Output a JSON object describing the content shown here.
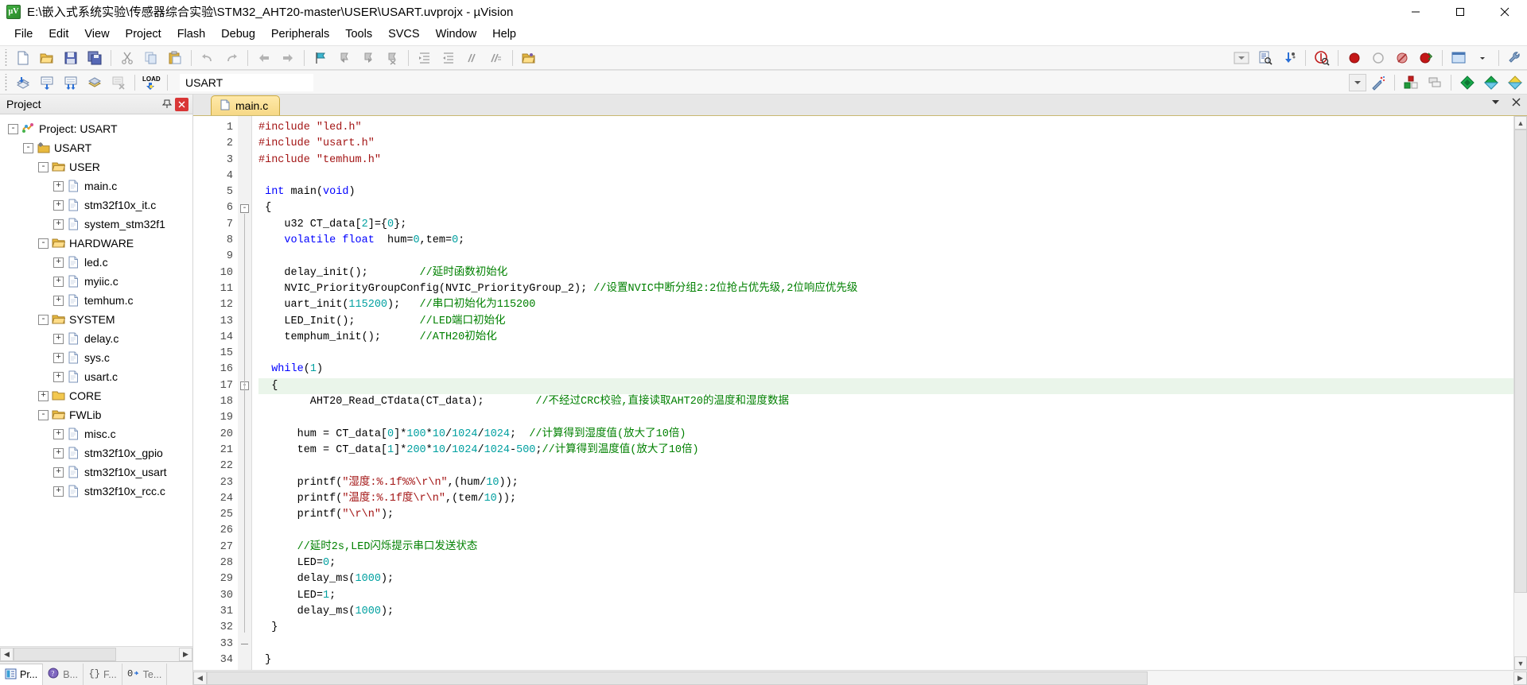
{
  "window": {
    "title": "E:\\嵌入式系统实验\\传感器综合实验\\STM32_AHT20-master\\USER\\USART.uvprojx - µVision",
    "app_icon": "uvision-logo-icon",
    "minimize": "minimize-button",
    "maximize": "maximize-button",
    "close": "close-button"
  },
  "menu": {
    "items": [
      "File",
      "Edit",
      "View",
      "Project",
      "Flash",
      "Debug",
      "Peripherals",
      "Tools",
      "SVCS",
      "Window",
      "Help"
    ]
  },
  "toolbar_main": {
    "buttons": [
      "new-file-icon",
      "open-file-icon",
      "save-icon",
      "save-all-icon",
      "cut-icon",
      "copy-icon",
      "paste-icon",
      "undo-icon",
      "redo-icon",
      "navigate-back-icon",
      "navigate-forward-icon",
      "bookmark-toggle-icon",
      "bookmark-prev-icon",
      "bookmark-next-icon",
      "bookmark-clear-icon",
      "indent-icon",
      "outdent-icon",
      "comment-icon",
      "uncomment-icon",
      "open-folder-icon",
      "dropdown-arrow-icon",
      "find-in-files-icon",
      "configure-icon",
      "debug-session-icon",
      "insert-breakpoint-icon",
      "remove-breakpoint-icon",
      "disable-breakpoint-icon",
      "kill-breakpoints-icon",
      "window-layout-icon",
      "layout-dropdown-icon",
      "configuration-wizard-icon"
    ]
  },
  "toolbar_build": {
    "buttons": [
      "translate-icon",
      "build-icon",
      "rebuild-icon",
      "batch-build-icon",
      "stop-build-icon",
      "load-icon"
    ],
    "target_label": "USART",
    "target_dropdown": "target-dropdown-icon",
    "after_buttons": [
      "magic-wand-icon",
      "manage-project-items-icon",
      "multi-project-icon",
      "pack-installer-icon",
      "manage-runtime-icon",
      "select-software-packs-icon"
    ]
  },
  "project_panel": {
    "title": "Project",
    "pin_icon": "pin-icon",
    "close_icon": "close-panel-icon",
    "tree": [
      {
        "label": "Project: USART",
        "depth": 0,
        "expander": "-",
        "icon": "project-icon"
      },
      {
        "label": "USART",
        "depth": 1,
        "expander": "-",
        "icon": "target-icon"
      },
      {
        "label": "USER",
        "depth": 2,
        "expander": "-",
        "icon": "folder-open-icon"
      },
      {
        "label": "main.c",
        "depth": 3,
        "expander": "+",
        "icon": "c-file-icon"
      },
      {
        "label": "stm32f10x_it.c",
        "depth": 3,
        "expander": "+",
        "icon": "c-file-icon"
      },
      {
        "label": "system_stm32f1",
        "depth": 3,
        "expander": "+",
        "icon": "c-file-icon"
      },
      {
        "label": "HARDWARE",
        "depth": 2,
        "expander": "-",
        "icon": "folder-open-icon"
      },
      {
        "label": "led.c",
        "depth": 3,
        "expander": "+",
        "icon": "c-file-icon"
      },
      {
        "label": "myiic.c",
        "depth": 3,
        "expander": "+",
        "icon": "c-file-icon"
      },
      {
        "label": "temhum.c",
        "depth": 3,
        "expander": "+",
        "icon": "c-file-icon"
      },
      {
        "label": "SYSTEM",
        "depth": 2,
        "expander": "-",
        "icon": "folder-open-icon"
      },
      {
        "label": "delay.c",
        "depth": 3,
        "expander": "+",
        "icon": "c-file-icon"
      },
      {
        "label": "sys.c",
        "depth": 3,
        "expander": "+",
        "icon": "c-file-icon"
      },
      {
        "label": "usart.c",
        "depth": 3,
        "expander": "+",
        "icon": "c-file-icon"
      },
      {
        "label": "CORE",
        "depth": 2,
        "expander": "+",
        "icon": "folder-closed-icon"
      },
      {
        "label": "FWLib",
        "depth": 2,
        "expander": "-",
        "icon": "folder-open-icon"
      },
      {
        "label": "misc.c",
        "depth": 3,
        "expander": "+",
        "icon": "c-file-icon"
      },
      {
        "label": "stm32f10x_gpio",
        "depth": 3,
        "expander": "+",
        "icon": "c-file-icon"
      },
      {
        "label": "stm32f10x_usart",
        "depth": 3,
        "expander": "+",
        "icon": "c-file-icon"
      },
      {
        "label": "stm32f10x_rcc.c",
        "depth": 3,
        "expander": "+",
        "icon": "c-file-icon"
      }
    ],
    "tabs": [
      {
        "label": "Pr...",
        "icon": "project-tab-icon",
        "active": true
      },
      {
        "label": "B...",
        "icon": "books-tab-icon",
        "active": false
      },
      {
        "label": "F...",
        "icon": "functions-tab-icon",
        "active": false
      },
      {
        "label": "Te...",
        "icon": "templates-tab-icon",
        "active": false
      }
    ]
  },
  "editor": {
    "tab": {
      "label": "main.c",
      "icon": "c-file-icon",
      "active": true
    },
    "tab_actions": [
      "tab-list-dropdown-icon",
      "close-document-icon"
    ],
    "highlight_line": 17,
    "lines": [
      {
        "n": 1,
        "fold": "",
        "tokens": [
          [
            "pre",
            "#include "
          ],
          [
            "str",
            "\"led.h\""
          ]
        ]
      },
      {
        "n": 2,
        "fold": "",
        "tokens": [
          [
            "pre",
            "#include "
          ],
          [
            "str",
            "\"usart.h\""
          ]
        ]
      },
      {
        "n": 3,
        "fold": "",
        "tokens": [
          [
            "pre",
            "#include "
          ],
          [
            "str",
            "\"temhum.h\""
          ]
        ]
      },
      {
        "n": 4,
        "fold": "",
        "tokens": []
      },
      {
        "n": 5,
        "fold": "",
        "tokens": [
          [
            "fn",
            " "
          ],
          [
            "kw",
            "int"
          ],
          [
            "fn",
            " main("
          ],
          [
            "kw",
            "void"
          ],
          [
            "fn",
            ")"
          ]
        ]
      },
      {
        "n": 6,
        "fold": "-",
        "tokens": [
          [
            "fn",
            " {"
          ]
        ]
      },
      {
        "n": 7,
        "fold": "",
        "tokens": [
          [
            "fn",
            "    u32 CT_data["
          ],
          [
            "num",
            "2"
          ],
          [
            "fn",
            "]={"
          ],
          [
            "num",
            "0"
          ],
          [
            "fn",
            "};"
          ]
        ]
      },
      {
        "n": 8,
        "fold": "",
        "tokens": [
          [
            "fn",
            "    "
          ],
          [
            "kw",
            "volatile float"
          ],
          [
            "fn",
            "  hum="
          ],
          [
            "num",
            "0"
          ],
          [
            "fn",
            ",tem="
          ],
          [
            "num",
            "0"
          ],
          [
            "fn",
            ";"
          ]
        ]
      },
      {
        "n": 9,
        "fold": "",
        "tokens": []
      },
      {
        "n": 10,
        "fold": "",
        "tokens": [
          [
            "fn",
            "    delay_init();        "
          ],
          [
            "cmt",
            "//延时函数初始化"
          ]
        ]
      },
      {
        "n": 11,
        "fold": "",
        "tokens": [
          [
            "fn",
            "    NVIC_PriorityGroupConfig(NVIC_PriorityGroup_2); "
          ],
          [
            "cmt",
            "//设置NVIC中断分组2:2位抢占优先级,2位响应优先级"
          ]
        ]
      },
      {
        "n": 12,
        "fold": "",
        "tokens": [
          [
            "fn",
            "    uart_init("
          ],
          [
            "num",
            "115200"
          ],
          [
            "fn",
            ");   "
          ],
          [
            "cmt",
            "//串口初始化为115200"
          ]
        ]
      },
      {
        "n": 13,
        "fold": "",
        "tokens": [
          [
            "fn",
            "    LED_Init();          "
          ],
          [
            "cmt",
            "//LED端口初始化"
          ]
        ]
      },
      {
        "n": 14,
        "fold": "",
        "tokens": [
          [
            "fn",
            "    temphum_init();      "
          ],
          [
            "cmt",
            "//ATH20初始化"
          ]
        ]
      },
      {
        "n": 15,
        "fold": "",
        "tokens": []
      },
      {
        "n": 16,
        "fold": "",
        "tokens": [
          [
            "fn",
            "  "
          ],
          [
            "kw",
            "while"
          ],
          [
            "fn",
            "("
          ],
          [
            "num",
            "1"
          ],
          [
            "fn",
            ")"
          ]
        ]
      },
      {
        "n": 17,
        "fold": "-",
        "tokens": [
          [
            "fn",
            "  {"
          ]
        ]
      },
      {
        "n": 18,
        "fold": "",
        "tokens": [
          [
            "fn",
            "        AHT20_Read_CTdata(CT_data);        "
          ],
          [
            "cmt",
            "//不经过CRC校验,直接读取AHT20的温度和湿度数据"
          ]
        ]
      },
      {
        "n": 19,
        "fold": "",
        "tokens": []
      },
      {
        "n": 20,
        "fold": "",
        "tokens": [
          [
            "fn",
            "      hum = CT_data["
          ],
          [
            "num",
            "0"
          ],
          [
            "fn",
            "]*"
          ],
          [
            "num",
            "100"
          ],
          [
            "fn",
            "*"
          ],
          [
            "num",
            "10"
          ],
          [
            "fn",
            "/"
          ],
          [
            "num",
            "1024"
          ],
          [
            "fn",
            "/"
          ],
          [
            "num",
            "1024"
          ],
          [
            "fn",
            ";  "
          ],
          [
            "cmt",
            "//计算得到湿度值(放大了10倍)"
          ]
        ]
      },
      {
        "n": 21,
        "fold": "",
        "tokens": [
          [
            "fn",
            "      tem = CT_data["
          ],
          [
            "num",
            "1"
          ],
          [
            "fn",
            "]*"
          ],
          [
            "num",
            "200"
          ],
          [
            "fn",
            "*"
          ],
          [
            "num",
            "10"
          ],
          [
            "fn",
            "/"
          ],
          [
            "num",
            "1024"
          ],
          [
            "fn",
            "/"
          ],
          [
            "num",
            "1024"
          ],
          [
            "fn",
            "-"
          ],
          [
            "num",
            "500"
          ],
          [
            "fn",
            ";"
          ],
          [
            "cmt",
            "//计算得到温度值(放大了10倍)"
          ]
        ]
      },
      {
        "n": 22,
        "fold": "",
        "tokens": []
      },
      {
        "n": 23,
        "fold": "",
        "tokens": [
          [
            "fn",
            "      printf("
          ],
          [
            "str",
            "\"湿度:%.1f%%\\r\\n\""
          ],
          [
            "fn",
            ",(hum/"
          ],
          [
            "num",
            "10"
          ],
          [
            "fn",
            "));"
          ]
        ]
      },
      {
        "n": 24,
        "fold": "",
        "tokens": [
          [
            "fn",
            "      printf("
          ],
          [
            "str",
            "\"温度:%.1f度\\r\\n\""
          ],
          [
            "fn",
            ",(tem/"
          ],
          [
            "num",
            "10"
          ],
          [
            "fn",
            "));"
          ]
        ]
      },
      {
        "n": 25,
        "fold": "",
        "tokens": [
          [
            "fn",
            "      printf("
          ],
          [
            "str",
            "\"\\r\\n\""
          ],
          [
            "fn",
            ");"
          ]
        ]
      },
      {
        "n": 26,
        "fold": "",
        "tokens": []
      },
      {
        "n": 27,
        "fold": "",
        "tokens": [
          [
            "fn",
            "      "
          ],
          [
            "cmt",
            "//延时2s,LED闪烁提示串口发送状态"
          ]
        ]
      },
      {
        "n": 28,
        "fold": "",
        "tokens": [
          [
            "fn",
            "      LED="
          ],
          [
            "num",
            "0"
          ],
          [
            "fn",
            ";"
          ]
        ]
      },
      {
        "n": 29,
        "fold": "",
        "tokens": [
          [
            "fn",
            "      delay_ms("
          ],
          [
            "num",
            "1000"
          ],
          [
            "fn",
            ");"
          ]
        ]
      },
      {
        "n": 30,
        "fold": "",
        "tokens": [
          [
            "fn",
            "      LED="
          ],
          [
            "num",
            "1"
          ],
          [
            "fn",
            ";"
          ]
        ]
      },
      {
        "n": 31,
        "fold": "",
        "tokens": [
          [
            "fn",
            "      delay_ms("
          ],
          [
            "num",
            "1000"
          ],
          [
            "fn",
            ");"
          ]
        ]
      },
      {
        "n": 32,
        "fold": "",
        "tokens": [
          [
            "fn",
            "  }"
          ]
        ]
      },
      {
        "n": 33,
        "fold": "|",
        "tokens": []
      },
      {
        "n": 34,
        "fold": "",
        "tokens": [
          [
            "fn",
            " }"
          ]
        ]
      }
    ]
  },
  "colors": {
    "keyword": "#0000ff",
    "string": "#a31515",
    "comment": "#008000",
    "number": "#00a0a0",
    "tab_active": "#f6d886",
    "highlight_line": "#eaf5ea"
  }
}
